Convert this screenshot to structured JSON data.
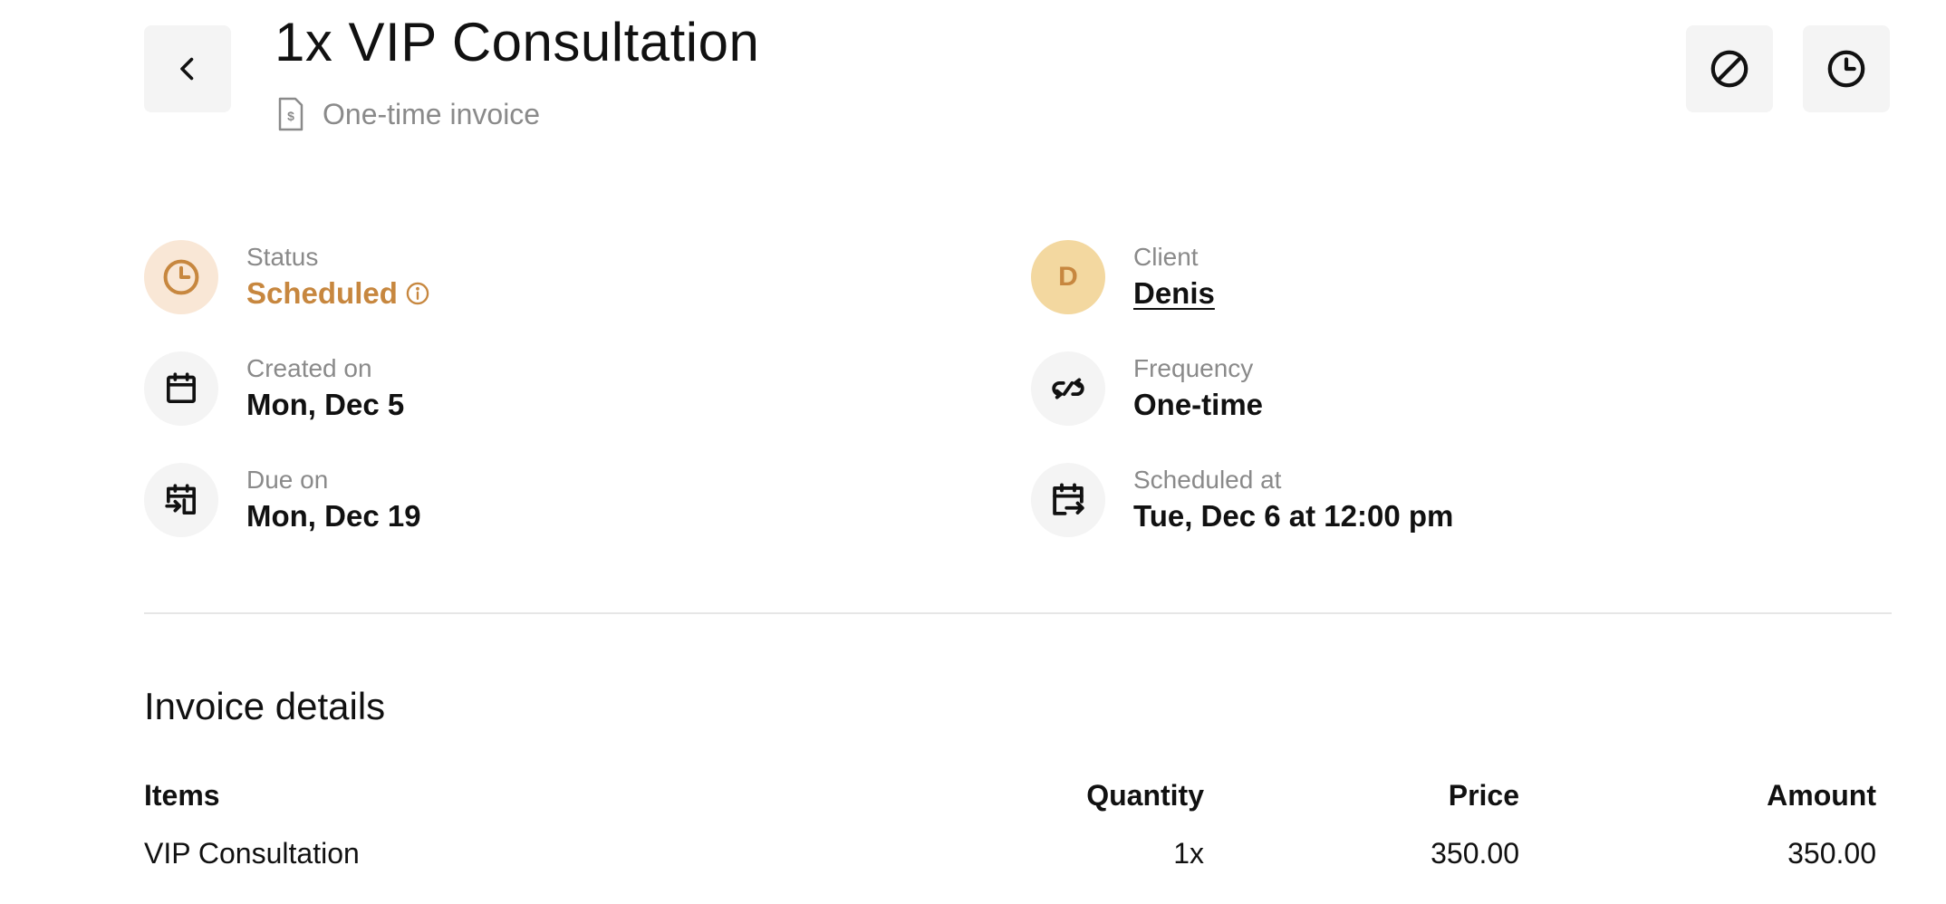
{
  "header": {
    "title": "1x VIP Consultation",
    "subtitle": "One-time invoice",
    "icons": {
      "back": "chevron-left-icon",
      "cancel": "ban-icon",
      "schedule": "clock-icon",
      "invoice": "invoice-document-icon"
    }
  },
  "details": {
    "status": {
      "label": "Status",
      "value": "Scheduled",
      "color": "#c7873f",
      "icon": "clock-icon"
    },
    "created": {
      "label": "Created on",
      "value": "Mon, Dec 5",
      "icon": "calendar-icon"
    },
    "due": {
      "label": "Due on",
      "value": "Mon, Dec 19",
      "icon": "calendar-due-icon"
    },
    "client": {
      "label": "Client",
      "value": "Denis",
      "avatar_initial": "D"
    },
    "frequency": {
      "label": "Frequency",
      "value": "One-time",
      "icon": "repeat-arrows-icon"
    },
    "scheduled": {
      "label": "Scheduled at",
      "value": "Tue, Dec 6 at 12:00 pm",
      "icon": "calendar-send-icon"
    }
  },
  "invoice": {
    "section_title": "Invoice details",
    "columns": [
      "Items",
      "Quantity",
      "Price",
      "Amount"
    ],
    "rows": [
      {
        "item": "VIP Consultation",
        "quantity": "1x",
        "price": "350.00",
        "amount": "350.00"
      }
    ]
  },
  "colors": {
    "accent": "#c7873f",
    "status_bg": "#f9e7d6",
    "avatar_bg": "#f3d8a0",
    "button_bg": "#f4f4f4",
    "muted_text": "#8a8a8a"
  }
}
